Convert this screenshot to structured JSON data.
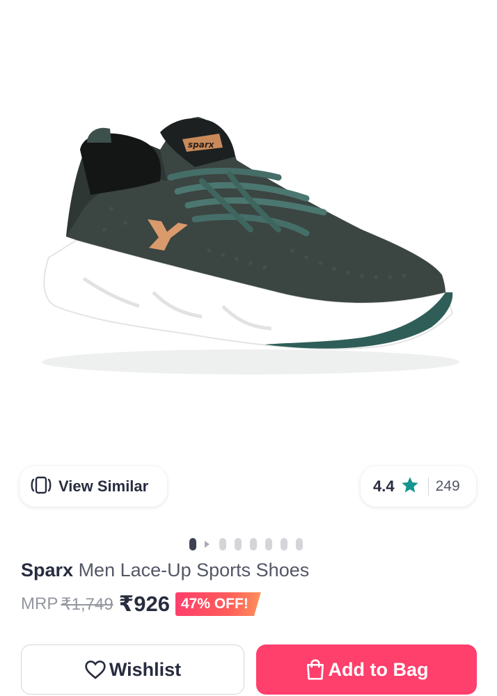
{
  "product": {
    "brand": "Sparx",
    "name": "Men Lace-Up Sports Shoes",
    "image_icon": "sports-shoe-image",
    "logo_text": "sparx"
  },
  "actions": {
    "view_similar_label": "View Similar",
    "view_similar_icon": "view-similar-icon",
    "wishlist_label": "Wishlist",
    "wishlist_icon": "heart-icon",
    "add_to_bag_label": "Add to Bag",
    "add_to_bag_icon": "shopping-bag-icon"
  },
  "rating": {
    "score": "4.4",
    "count": "249",
    "star_icon": "star-icon",
    "star_color": "#14958f"
  },
  "carousel": {
    "total_images": 8,
    "active_index": 0
  },
  "pricing": {
    "mrp_label": "MRP",
    "mrp_value": "₹1,749",
    "price": "₹926",
    "discount": "47% OFF!"
  },
  "colors": {
    "accent": "#ff3f6c",
    "text_primary": "#282c3f",
    "text_muted": "#94969f"
  }
}
